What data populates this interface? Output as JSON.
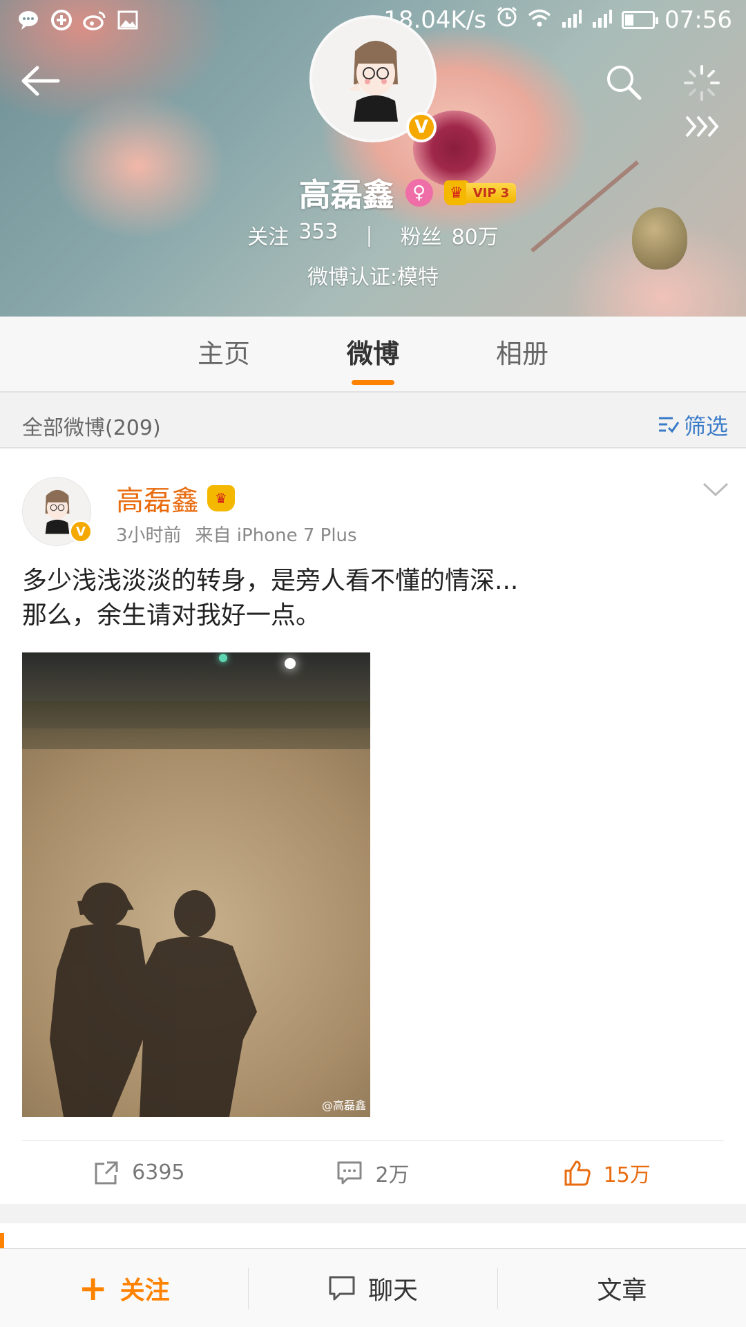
{
  "status_bar": {
    "left_icons": [
      "chat-bubble-icon",
      "sync-icon",
      "weibo-icon",
      "image-icon"
    ],
    "net_speed": "18.04K/s",
    "right_icons": [
      "alarm-icon",
      "wifi-icon",
      "signal-icon",
      "signal-icon",
      "battery-icon"
    ],
    "time": "07:56"
  },
  "header": {
    "icons": [
      "back-arrow-icon",
      "search-icon",
      "loading-icon",
      "more-chevrons-icon"
    ],
    "profile": {
      "name": "高磊鑫",
      "gender_icon": "female-symbol-icon",
      "vip_label": "VIP 3",
      "verified": true,
      "follow_label": "关注",
      "follow_count": "353",
      "separator": "|",
      "fans_label": "粉丝",
      "fans_count": "80万",
      "verification": "微博认证:模特"
    }
  },
  "tabs": [
    {
      "label": "主页",
      "active": false
    },
    {
      "label": "微博",
      "active": true
    },
    {
      "label": "相册",
      "active": false
    }
  ],
  "filter_bar": {
    "all_count": "全部微博(209)",
    "filter_label": "筛选"
  },
  "post": {
    "author": "高磊鑫",
    "time": "3小时前",
    "source": "来自 iPhone 7 Plus",
    "text_line1": "多少浅浅淡淡的转身，是旁人看不懂的情深...",
    "text_line2": "那么，余生请对我好一点。",
    "image_watermark": "@高磊鑫",
    "actions": {
      "repost_count": "6395",
      "comment_count": "2万",
      "like_count": "15万"
    }
  },
  "accent_colors": {
    "orange": "#ff8200",
    "author_orange": "#e86b0e",
    "link_blue": "#3a7bc8",
    "verify_gold": "#f5a800"
  },
  "bottom_bar": {
    "follow": "关注",
    "chat": "聊天",
    "article": "文章"
  }
}
